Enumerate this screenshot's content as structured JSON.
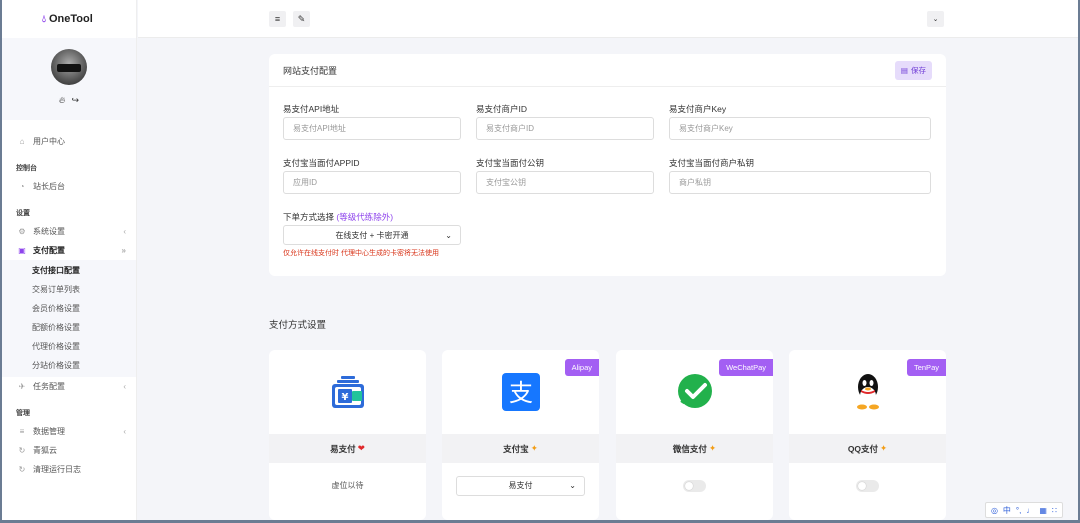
{
  "app": {
    "name": "OneTool"
  },
  "sidebar": {
    "items": [
      {
        "label": "用户中心"
      },
      {
        "head": "控制台"
      },
      {
        "label": "站长后台"
      },
      {
        "head": "设置"
      },
      {
        "label": "系统设置"
      },
      {
        "label": "支付配置"
      },
      {
        "label": "任务配置"
      },
      {
        "head": "管理"
      },
      {
        "label": "数据管理"
      },
      {
        "label": "青狐云"
      },
      {
        "label": "清理运行日志"
      }
    ],
    "sub": [
      "支付接口配置",
      "交易订单列表",
      "会员价格设置",
      "配额价格设置",
      "代理价格设置",
      "分站价格设置"
    ]
  },
  "config": {
    "title": "网站支付配置",
    "save_label": "保存",
    "fields": [
      {
        "label": "易支付API地址",
        "placeholder": "易支付API地址"
      },
      {
        "label": "易支付商户ID",
        "placeholder": "易支付商户ID"
      },
      {
        "label": "易支付商户Key",
        "placeholder": "易支付商户Key"
      },
      {
        "label": "支付宝当面付APPID",
        "placeholder": "应用ID"
      },
      {
        "label": "支付宝当面付公钥",
        "placeholder": "支付宝公钥"
      },
      {
        "label": "支付宝当面付商户私钥",
        "placeholder": "商户私钥"
      }
    ],
    "order_method_label": "下单方式选择",
    "order_method_hint": "(等级代练除外)",
    "order_method_value": "在线支付 + 卡密开通",
    "warning": "仅允许在线支付时 代理中心生成的卡密将无法使用"
  },
  "methods": {
    "title": "支付方式设置",
    "cards": [
      {
        "name": "易支付",
        "suffix": "❤",
        "body": "虚位以待"
      },
      {
        "name": "支付宝",
        "suffix": "✦",
        "badge": "Alipay",
        "select": "易支付"
      },
      {
        "name": "微信支付",
        "suffix": "✦",
        "badge": "WeChatPay"
      },
      {
        "name": "QQ支付",
        "suffix": "✦",
        "badge": "TenPay"
      }
    ]
  },
  "tray": {
    "lang": "中"
  },
  "colors": {
    "accent": "#8e44ec",
    "warning": "#d9361b"
  }
}
